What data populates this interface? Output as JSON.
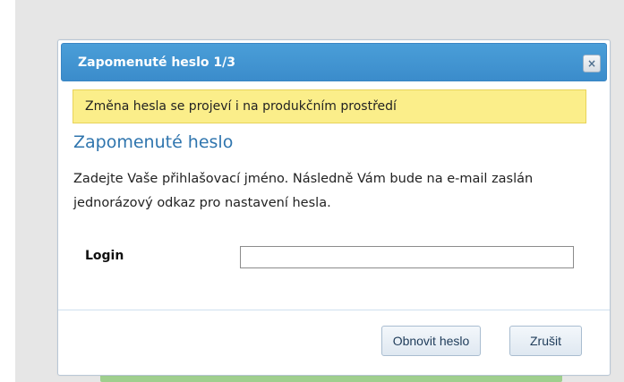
{
  "dialog": {
    "title": "Zapomenuté heslo 1/3",
    "close_symbol": "×",
    "warning": "Změna hesla se projeví i na produkčním prostředí",
    "heading": "Zapomenuté heslo",
    "description": "Zadejte Vaše přihlašovací jméno. Následně Vám bude na e-mail zaslán jednorázový odkaz pro nastavení hesla.",
    "login_label": "Login",
    "login_value": "",
    "reset_button": "Obnovit heslo",
    "cancel_button": "Zrušit"
  },
  "colors": {
    "titlebar": "#3b8ccb",
    "warning_bg": "#fbee8a",
    "heading": "#2f75ae"
  }
}
